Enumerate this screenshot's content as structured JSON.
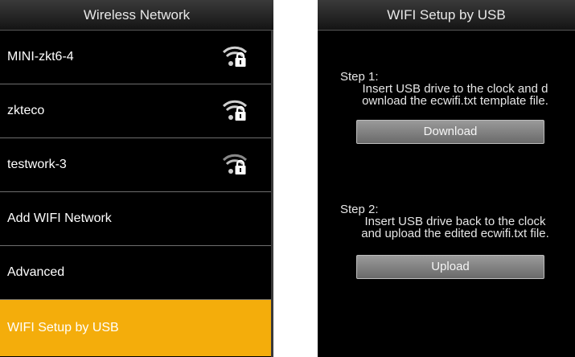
{
  "left_screen": {
    "title": "Wireless Network",
    "networks": [
      {
        "ssid": "MINI-zkt6-4",
        "icon": "wifi-lock-icon"
      },
      {
        "ssid": "zkteco",
        "icon": "wifi-lock-icon"
      },
      {
        "ssid": "testwork-3",
        "icon": "wifi-lock-icon"
      }
    ],
    "menu": {
      "add_network": "Add WIFI Network",
      "advanced": "Advanced",
      "setup_by_usb": "WIFI Setup by USB"
    },
    "selected_color": "#f4ad0b"
  },
  "right_screen": {
    "title": "WIFI Setup by USB",
    "step1": {
      "heading": "Step 1:",
      "line1": "Insert USB drive to the clock and d",
      "line2": "ownload the ecwifi.txt template file.",
      "button": "Download"
    },
    "step2": {
      "heading": "Step 2:",
      "line1": "Insert USB drive back to the clock",
      "line2": "and upload the edited ecwifi.txt file.",
      "button": "Upload"
    }
  }
}
